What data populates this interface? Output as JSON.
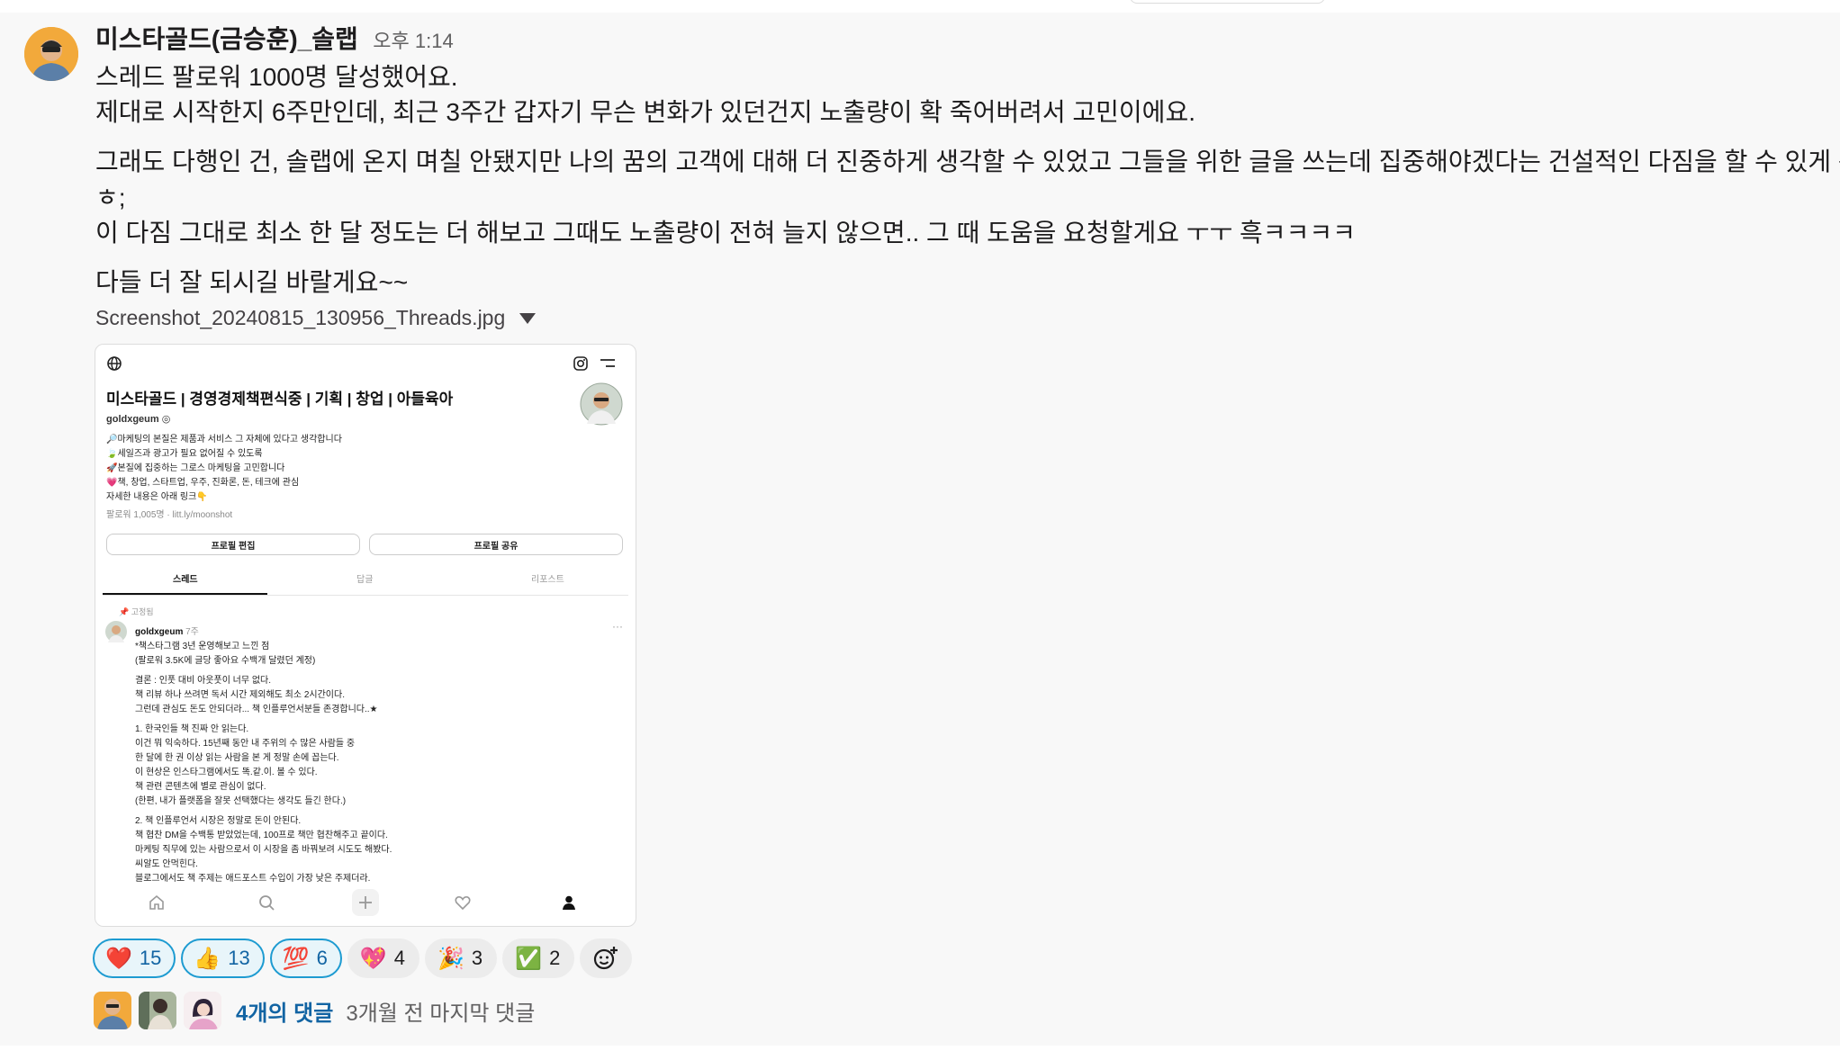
{
  "message": {
    "author": "미스타골드(금승훈)_솔랩",
    "time": "오후 1:14",
    "lines": [
      "스레드 팔로워 1000명 달성했어요.",
      "제대로 시작한지 6주만인데, 최근 3주간 갑자기 무슨 변화가 있던건지 노출량이 확 죽어버려서 고민이에요.",
      "그래도 다행인 건, 솔랩에 온지 며칠 안됐지만 나의 꿈의 고객에 대해 더 진중하게 생각할 수 있었고 그들을 위한 글을 쓰는데 집중해야겠다는 건설적인 다짐을 할 수 있게 됐어요.",
      "ㅎ;",
      "이 다짐 그대로 최소 한 달 정도는 더 해보고 그때도 노출량이 전혀 늘지 않으면.. 그 때 도움을 요청할게요 ㅜㅜ 흑ㅋㅋㅋㅋ",
      "다들 더 잘 되시길 바랄게요~~"
    ]
  },
  "attachment": {
    "filename": "Screenshot_20240815_130956_Threads.jpg",
    "profile": {
      "title": "미스타골드 | 경영경제책편식중 | 기획 | 창업 | 아들육아",
      "handle": "goldxgeum ◎",
      "bio": [
        "🔎마케팅의 본질은 제품과 서비스 그 자체에 있다고 생각합니다",
        "🍃세일즈과 광고가 필요 없어질 수 있도록",
        "🚀본질에 집중하는 그로스 마케팅을 고민합니다",
        "💗책, 창업, 스타트업, 우주, 진화론, 돈, 테크에 관심",
        "자세한 내용은 아래 링크👇"
      ],
      "followers": "팔로워 1,005명 · litt.ly/moonshot",
      "edit_button": "프로필 편집",
      "share_button": "프로필 공유",
      "tabs": [
        "스레드",
        "답글",
        "리포스트"
      ],
      "pinned": "고정됨",
      "post_author": "goldxgeum",
      "post_age": "7주",
      "post_more": "···",
      "post_lines": [
        "*책스타그램 3년 운영해보고 느낀 점",
        "(팔로워 3.5K에 글당 좋아요 수백개 달렸던 계정)",
        "",
        "결론 : 인풋 대비 아웃풋이 너무 없다.",
        "책 리뷰 하나 쓰려면 독서 시간 제외해도 최소 2시간이다.",
        "그런데 관심도 돈도 안되더라... 책 인플루언서분들 존경합니다..★",
        "",
        "1. 한국인들 책 진짜 안 읽는다.",
        "이건 뭐 익숙하다. 15년째 동안 내 주위의 수 많은 사람들 중",
        "한 달에 한 권 이상 읽는 사람을 본 게 정말 손에 꼽는다.",
        "이 현상은 인스타그램에서도 똑.같.이. 볼 수 있다.",
        "책 관련 콘텐츠에 별로 관심이 없다.",
        "(한편, 내가 플랫폼을 잘못 선택했다는 생각도 들긴 한다.)",
        "",
        "2. 책 인플루언서 시장은 정말로 돈이 안된다.",
        "책 협찬 DM을 수백통 받았었는데, 100프로 책만 협찬해주고 끝이다.",
        "마케팅 직무에 있는 사람으로서 이 시장을 좀 바꿔보려 시도도 해봤다.",
        "씨알도 안먹힌다.",
        "블로그에서도 책 주제는 애드포스트 수입이 가장 낮은 주제더라."
      ]
    }
  },
  "reactions": [
    {
      "emoji": "❤️",
      "count": "15",
      "mine": true
    },
    {
      "emoji": "👍",
      "count": "13",
      "mine": true
    },
    {
      "emoji": "💯",
      "count": "6",
      "mine": true
    },
    {
      "emoji": "💖",
      "count": "4",
      "mine": false
    },
    {
      "emoji": "🎉",
      "count": "3",
      "mine": false
    },
    {
      "emoji": "✅",
      "count": "2",
      "mine": false
    }
  ],
  "thread": {
    "count_label": "4개의 댓글",
    "last_reply": "3개월 전 마지막 댓글"
  }
}
